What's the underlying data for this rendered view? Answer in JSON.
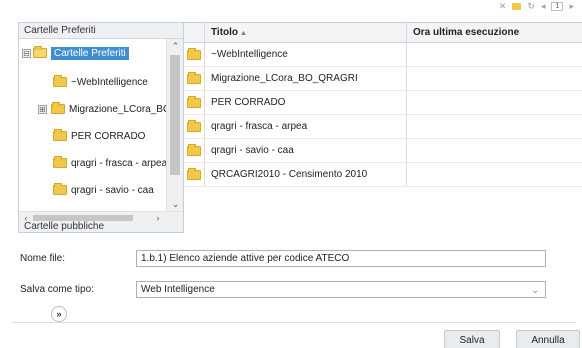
{
  "tree": {
    "header": "Cartelle Preferiti",
    "items": [
      {
        "label": "Cartelle Preferiti",
        "expander": "⊟",
        "selected": true
      },
      {
        "label": "~WebIntelligence"
      },
      {
        "label": "Migrazione_LCora_BO_QR",
        "expander": "⊞"
      },
      {
        "label": "PER CORRADO"
      },
      {
        "label": "qragri - frasca - arpea"
      },
      {
        "label": "qragri - savio - caa"
      }
    ],
    "public_header": "Cartelle pubbliche"
  },
  "list": {
    "columns": {
      "title": "Titolo",
      "date": "Ora ultima esecuzione"
    },
    "sort_indicator": "▲",
    "rows": [
      {
        "title": "~WebIntelligence"
      },
      {
        "title": "Migrazione_LCora_BO_QRAGRI"
      },
      {
        "title": "PER CORRADO"
      },
      {
        "title": "qragri - frasca - arpea"
      },
      {
        "title": "qragri - savio - caa"
      },
      {
        "title": "QRCAGRI2010 - Censimento 2010"
      }
    ]
  },
  "form": {
    "file_name_label": "Nome file:",
    "file_name_value": "1.b.1) Elenco aziende attive per codice ATECO",
    "save_as_label": "Salva come tipo:",
    "save_as_value": "Web Intelligence"
  },
  "toolbar": {
    "page_number": "1"
  },
  "expand_label": "»",
  "buttons": {
    "save": "Salva",
    "cancel": "Annulla"
  },
  "colors": {
    "selection": "#3e8ed0",
    "folder": "#f1c84b"
  }
}
